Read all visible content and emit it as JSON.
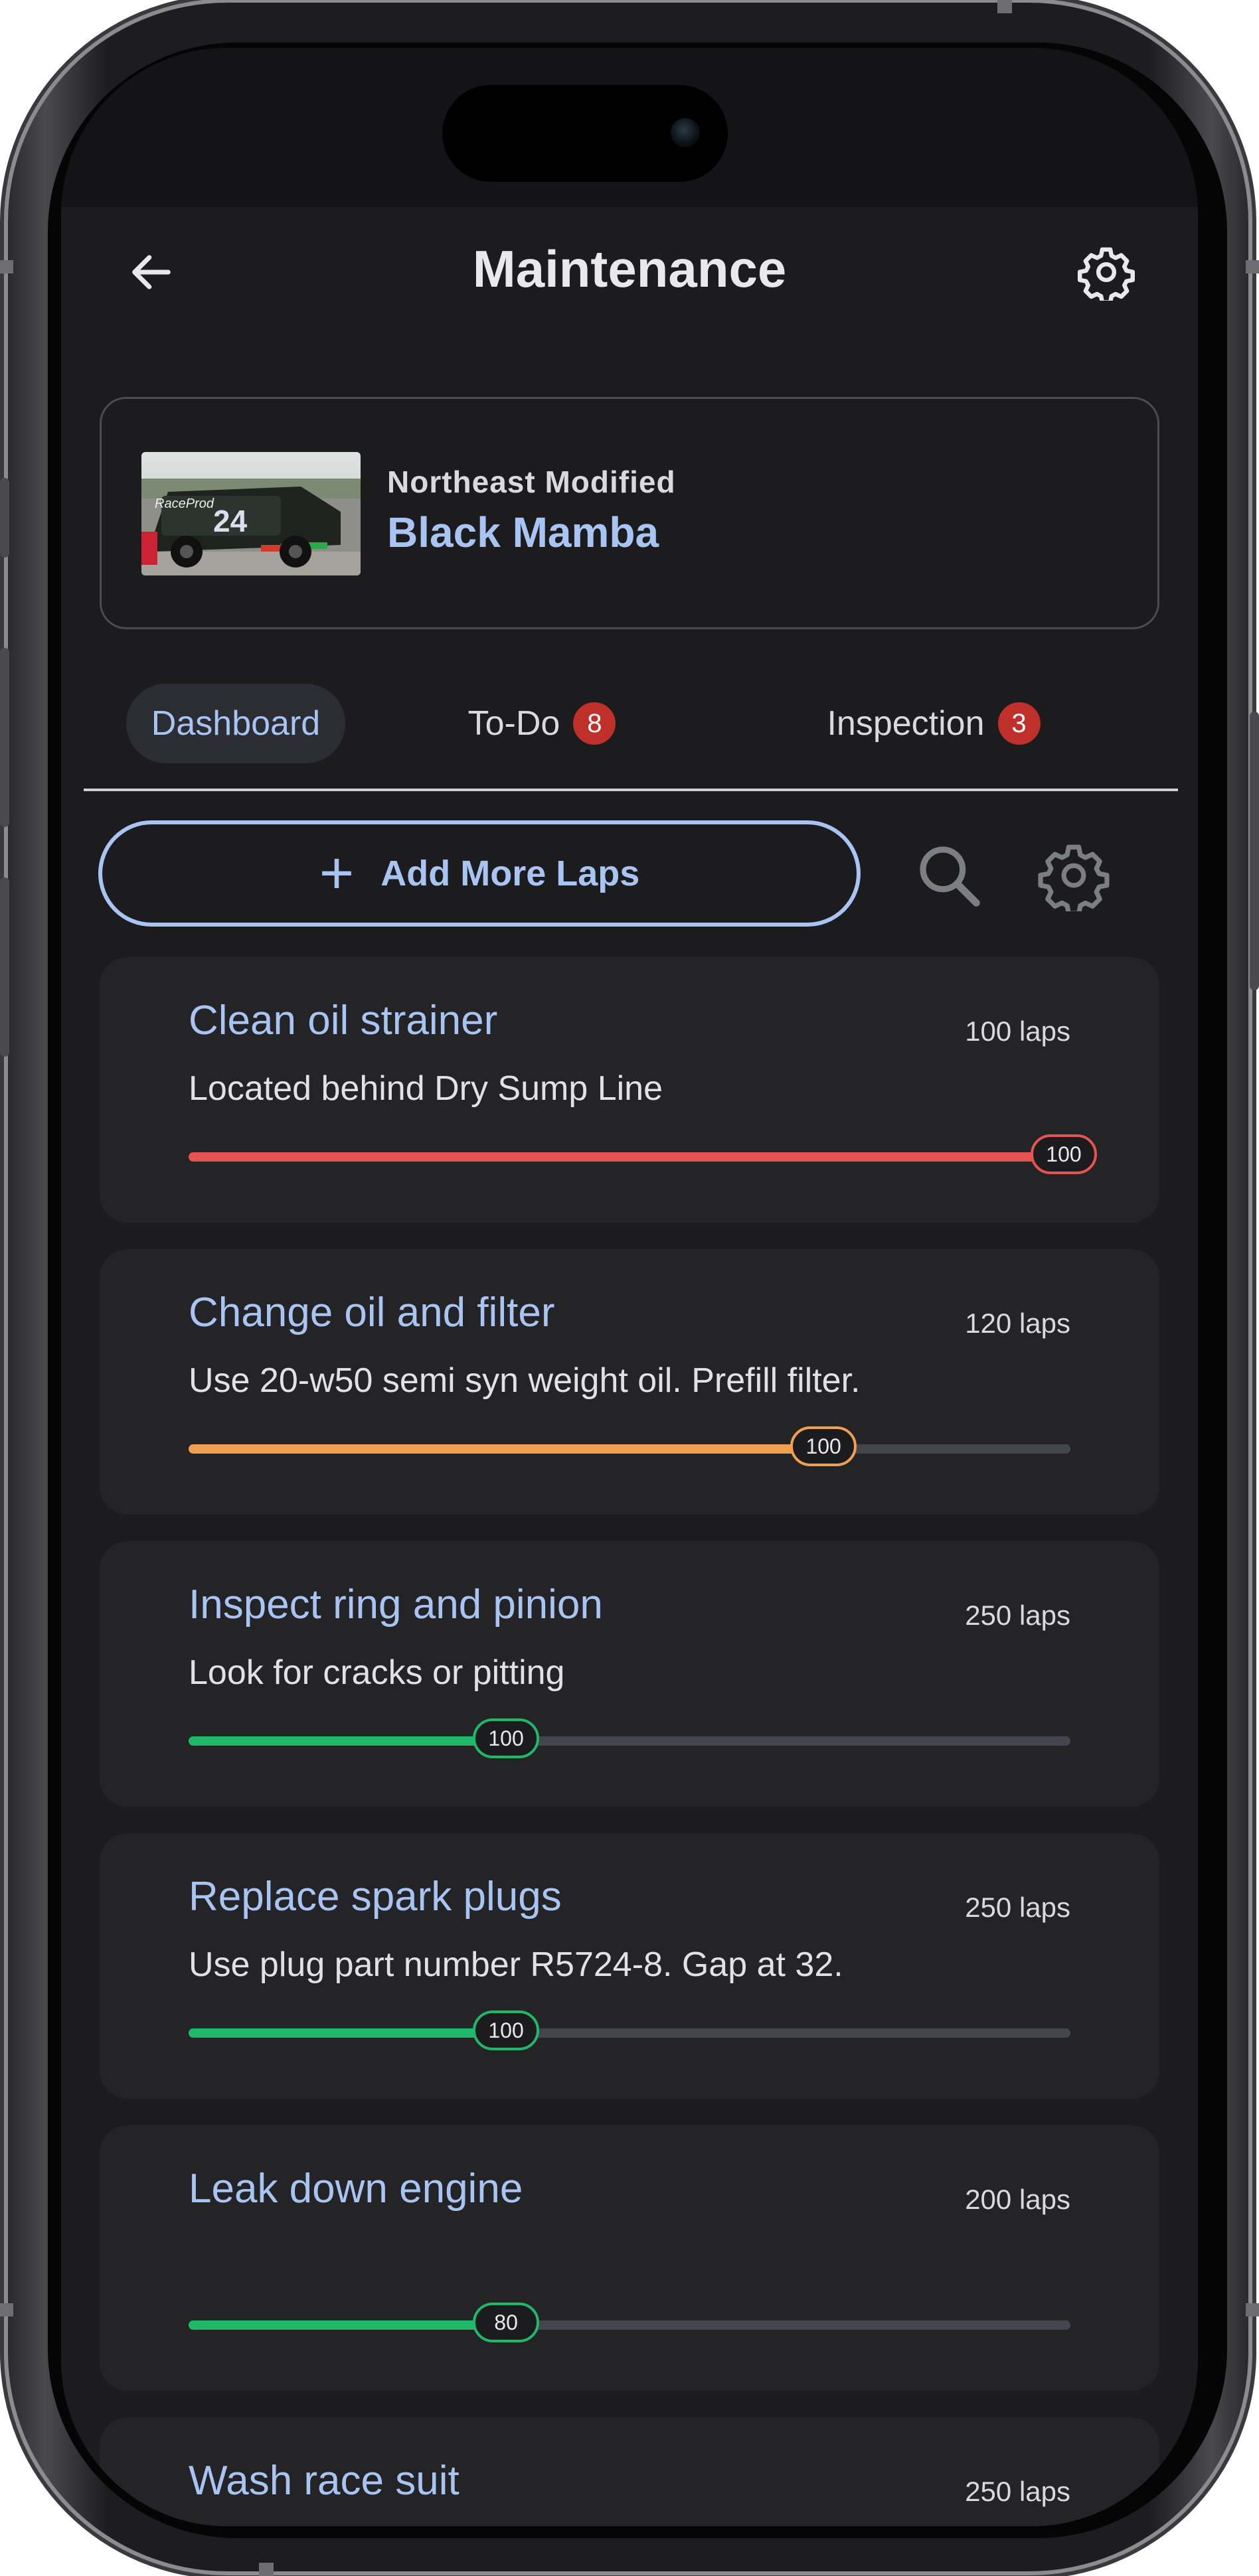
{
  "header": {
    "title": "Maintenance",
    "back_icon": "arrow-left-icon",
    "settings_icon": "gear-icon"
  },
  "car": {
    "category": "Northeast Modified",
    "name": "Black Mamba",
    "thumb_number": "24",
    "thumb_brand": "RaceProd"
  },
  "tabs": [
    {
      "label": "Dashboard",
      "active": true
    },
    {
      "label": "To-Do",
      "badge": "8"
    },
    {
      "label": "Inspection",
      "badge": "3"
    }
  ],
  "actions": {
    "add_laps_label": "Add More Laps",
    "add_icon": "plus-icon",
    "search_icon": "search-icon",
    "settings_icon": "gear-icon"
  },
  "colors": {
    "accent": "#a8c4f2",
    "red": "#e55353",
    "orange": "#f0a050",
    "green": "#1fb86a",
    "badge": "#c0302b"
  },
  "tasks": [
    {
      "title": "Clean oil strainer",
      "laps": "100 laps",
      "desc": "Located behind Dry Sump Line",
      "value": "100",
      "progress": 1.0,
      "color": "red"
    },
    {
      "title": "Change oil and filter",
      "laps": "120 laps",
      "desc": "Use 20-w50 semi syn weight oil. Prefill filter.",
      "value": "100",
      "progress": 0.72,
      "color": "orange"
    },
    {
      "title": "Inspect ring and pinion",
      "laps": "250 laps",
      "desc": "Look for cracks or pitting",
      "value": "100",
      "progress": 0.36,
      "color": "green"
    },
    {
      "title": "Replace spark plugs",
      "laps": "250 laps",
      "desc": "Use plug part number R5724-8. Gap at 32.",
      "value": "100",
      "progress": 0.36,
      "color": "green"
    },
    {
      "title": "Leak down engine",
      "laps": "200 laps",
      "desc": "",
      "value": "80",
      "progress": 0.36,
      "color": "green"
    },
    {
      "title": "Wash race suit",
      "laps": "250 laps",
      "desc": "",
      "value": "",
      "progress": 0.0,
      "color": "green"
    }
  ]
}
